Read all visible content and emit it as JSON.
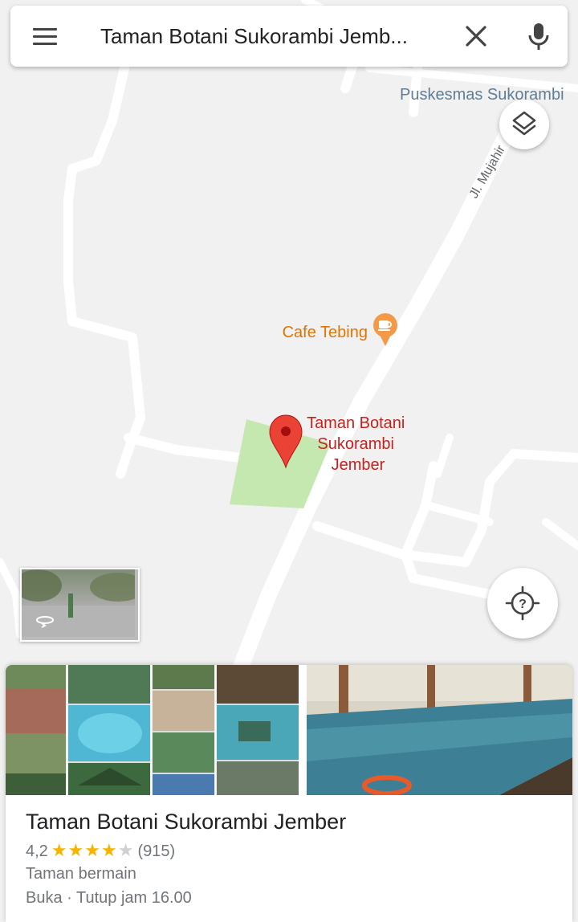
{
  "search": {
    "query": "Taman Botani Sukorambi Jemb..."
  },
  "map": {
    "labels": {
      "puskesmas": "Puskesmas Sukorambi",
      "road": "Jl. Mujahir",
      "cafe": "Cafe Tebing",
      "place_line1": "Taman Botani",
      "place_line2": "Sukorambi",
      "place_line3": "Jember"
    },
    "colors": {
      "background": "#f1f1f1",
      "road": "#ffffff",
      "park": "#c5e8b0",
      "pin": "#ea4335",
      "place_label": "#c5221f",
      "cafe_label": "#e37400",
      "poi_label": "#5f7e96"
    }
  },
  "icons": {
    "menu": "menu-icon",
    "clear": "close-icon",
    "mic": "microphone-icon",
    "layers": "layers-icon",
    "locate": "my-location-icon",
    "street_view": "street-view-360-icon",
    "cafe": "coffee-cup-icon",
    "pin": "map-pin-icon"
  },
  "place": {
    "title": "Taman Botani Sukorambi Jember",
    "rating": "4,2",
    "stars_rating": 4.2,
    "stars": "★★★★",
    "stars_empty": "★",
    "reviews": "(915)",
    "category": "Taman bermain",
    "hours": "Buka · Tutup jam 16.00",
    "star_color": "#f6b400"
  }
}
